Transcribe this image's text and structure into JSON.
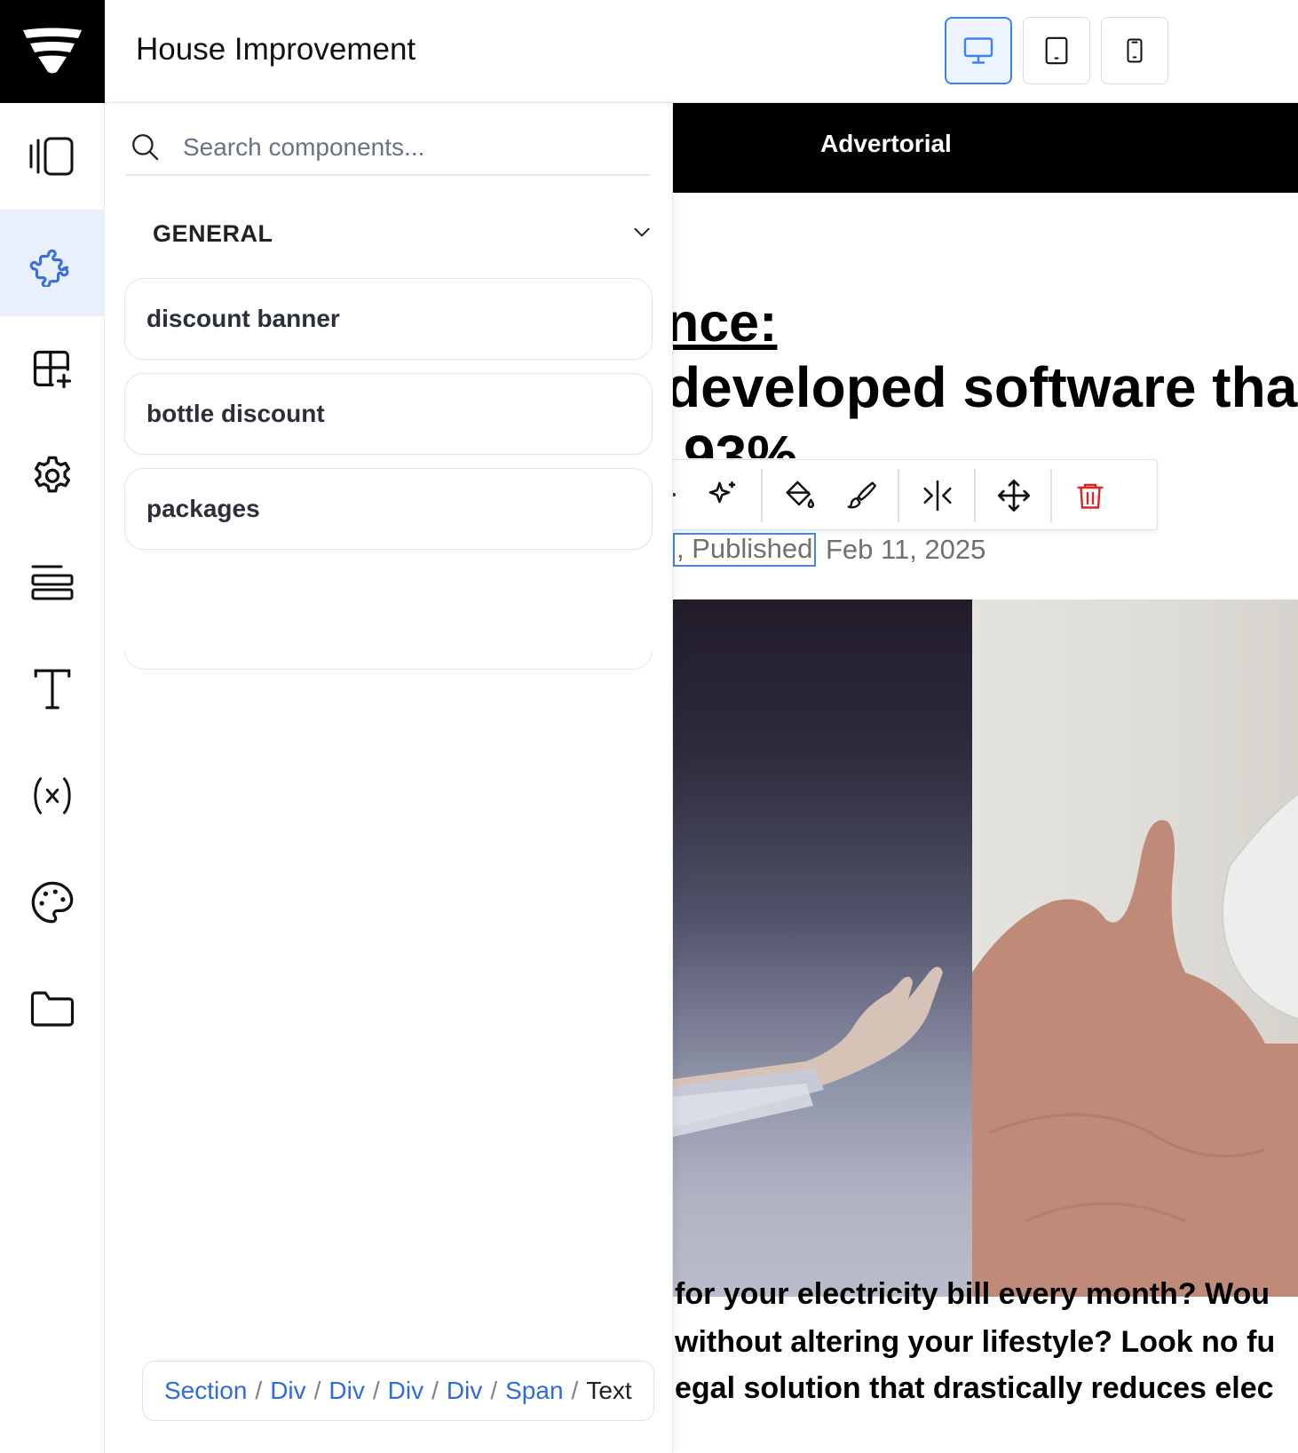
{
  "header": {
    "title": "House Improvement",
    "logo_icon": "brand-funnel-icon",
    "devices": [
      {
        "name": "desktop",
        "icon": "monitor-icon",
        "active": true
      },
      {
        "name": "tablet",
        "icon": "tablet-icon",
        "active": false
      },
      {
        "name": "mobile",
        "icon": "smartphone-icon",
        "active": false
      }
    ]
  },
  "rail": {
    "items": [
      {
        "icon": "panel-toggle-icon"
      },
      {
        "icon": "puzzle-icon",
        "active": true
      },
      {
        "icon": "layout-plus-icon"
      },
      {
        "icon": "gear-icon"
      },
      {
        "icon": "align-left-icon"
      },
      {
        "icon": "type-icon"
      },
      {
        "icon": "variable-icon"
      },
      {
        "icon": "palette-icon"
      },
      {
        "icon": "folder-icon"
      }
    ]
  },
  "panel": {
    "search": {
      "placeholder": "Search components...",
      "value": ""
    },
    "section": {
      "title": "GENERAL",
      "expanded": true
    },
    "components": [
      "discount banner",
      "bottle discount",
      "packages"
    ],
    "breadcrumb": {
      "links": [
        "Section",
        "Div",
        "Div",
        "Div",
        "Div",
        "Span"
      ],
      "separator": "/",
      "current": "Text"
    }
  },
  "canvas": {
    "banner_text": "Advertorial",
    "headline_line1": "nce:",
    "headline_line2": "developed software that",
    "headline_line3": "93%",
    "byline_selected": ", Published",
    "date": "Feb 11, 2025",
    "toolbar": [
      "sparkles-icon",
      "paint-bucket-icon",
      "brush-icon",
      "split-icon",
      "move-icon",
      "trash-icon"
    ],
    "body_line1": "for your electricity bill every month? Wou",
    "body_line2": "without altering your lifestyle? Look no fu",
    "body_line3": "egal solution that drastically reduces elec",
    "colors": {
      "accent": "#3b82f6",
      "link": "#2f6be0",
      "danger": "#dc2626",
      "banner": "#000000"
    }
  }
}
